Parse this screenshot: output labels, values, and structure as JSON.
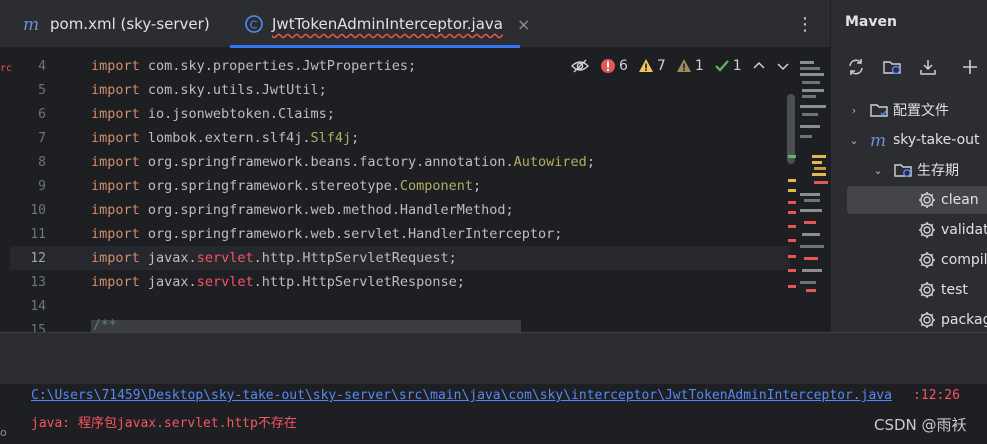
{
  "tabs": [
    {
      "label": "pom.xml (sky-server)",
      "icon": "maven-m-icon"
    },
    {
      "label": "JwtTokenAdminInterceptor.java",
      "icon": "java-class-icon",
      "close": "×"
    }
  ],
  "tab_menu": "⋮",
  "editor": {
    "lines": [
      {
        "num": "4",
        "code": [
          {
            "t": "import ",
            "c": "kw"
          },
          {
            "t": "com.sky.properties.JwtProperties",
            "c": ""
          },
          {
            "t": ";",
            "c": "semi"
          }
        ]
      },
      {
        "num": "5",
        "code": [
          {
            "t": "import ",
            "c": "kw"
          },
          {
            "t": "com.sky.utils.JwtUtil",
            "c": ""
          },
          {
            "t": ";",
            "c": "semi"
          }
        ]
      },
      {
        "num": "6",
        "code": [
          {
            "t": "import ",
            "c": "kw"
          },
          {
            "t": "io.jsonwebtoken.Claims",
            "c": ""
          },
          {
            "t": ";",
            "c": "semi"
          }
        ]
      },
      {
        "num": "7",
        "code": [
          {
            "t": "import ",
            "c": "kw"
          },
          {
            "t": "lombok.extern.slf4j.",
            "c": ""
          },
          {
            "t": "Slf4j",
            "c": "ann"
          },
          {
            "t": ";",
            "c": "semi"
          }
        ]
      },
      {
        "num": "8",
        "code": [
          {
            "t": "import ",
            "c": "kw"
          },
          {
            "t": "org.springframework.beans.factory.annotation.",
            "c": ""
          },
          {
            "t": "Autowired",
            "c": "ann"
          },
          {
            "t": ";",
            "c": "semi"
          }
        ]
      },
      {
        "num": "9",
        "code": [
          {
            "t": "import ",
            "c": "kw"
          },
          {
            "t": "org.springframework.stereotype.",
            "c": ""
          },
          {
            "t": "Component",
            "c": "ann"
          },
          {
            "t": ";",
            "c": "semi"
          }
        ]
      },
      {
        "num": "10",
        "code": [
          {
            "t": "import ",
            "c": "kw"
          },
          {
            "t": "org.springframework.web.method.HandlerMethod",
            "c": ""
          },
          {
            "t": ";",
            "c": "semi"
          }
        ]
      },
      {
        "num": "11",
        "code": [
          {
            "t": "import ",
            "c": "kw"
          },
          {
            "t": "org.springframework.web.servlet.HandlerInterceptor",
            "c": ""
          },
          {
            "t": ";",
            "c": "semi"
          }
        ]
      },
      {
        "num": "12",
        "code": [
          {
            "t": "import ",
            "c": "kw"
          },
          {
            "t": "javax.",
            "c": ""
          },
          {
            "t": "servlet",
            "c": "pkg-red"
          },
          {
            "t": ".http.HttpServletRequest",
            "c": ""
          },
          {
            "t": ";",
            "c": "semi"
          }
        ],
        "current": true
      },
      {
        "num": "13",
        "code": [
          {
            "t": "import ",
            "c": "kw"
          },
          {
            "t": "javax.",
            "c": ""
          },
          {
            "t": "servlet",
            "c": "pkg-red"
          },
          {
            "t": ".http.HttpServletResponse",
            "c": ""
          },
          {
            "t": ";",
            "c": "semi"
          }
        ]
      },
      {
        "num": "14",
        "code": []
      },
      {
        "num": "15",
        "code": []
      }
    ],
    "doc_start": "/**",
    "left_marker": "rc"
  },
  "inspections": {
    "errors": "6",
    "warnings": "7",
    "weak_warnings": "1",
    "typos": "1"
  },
  "maven": {
    "title": "Maven",
    "tree": [
      {
        "label": "配置文件",
        "icon": "folder-config-icon",
        "arrow": "›",
        "indent": 0
      },
      {
        "label": "sky-take-out",
        "icon": "maven-m-icon",
        "arrow": "⌄",
        "indent": 0
      },
      {
        "label": "生存期",
        "icon": "folder-lifecycle-icon",
        "arrow": "⌄",
        "indent": 1
      },
      {
        "label": "clean",
        "icon": "gear-icon",
        "arrow": "",
        "indent": 2,
        "selected": true
      },
      {
        "label": "validate",
        "icon": "gear-icon",
        "arrow": "",
        "indent": 2
      },
      {
        "label": "compile",
        "icon": "gear-icon",
        "arrow": "",
        "indent": 2
      },
      {
        "label": "test",
        "icon": "gear-icon",
        "arrow": "",
        "indent": 2
      },
      {
        "label": "package",
        "icon": "gear-icon",
        "arrow": "",
        "indent": 2
      }
    ]
  },
  "console": {
    "path": "C:\\Users\\71459\\Desktop\\sky-take-out\\sky-server\\src\\main\\java\\com\\sky\\interceptor\\JwtTokenAdminInterceptor.java",
    "position": ":12:26",
    "message": "java: 程序包javax.servlet.http不存在",
    "left_cut": "o"
  },
  "watermark": "CSDN @雨袄",
  "colors": {
    "accent": "#3574f0",
    "error": "#f75464",
    "link": "#548af7"
  }
}
